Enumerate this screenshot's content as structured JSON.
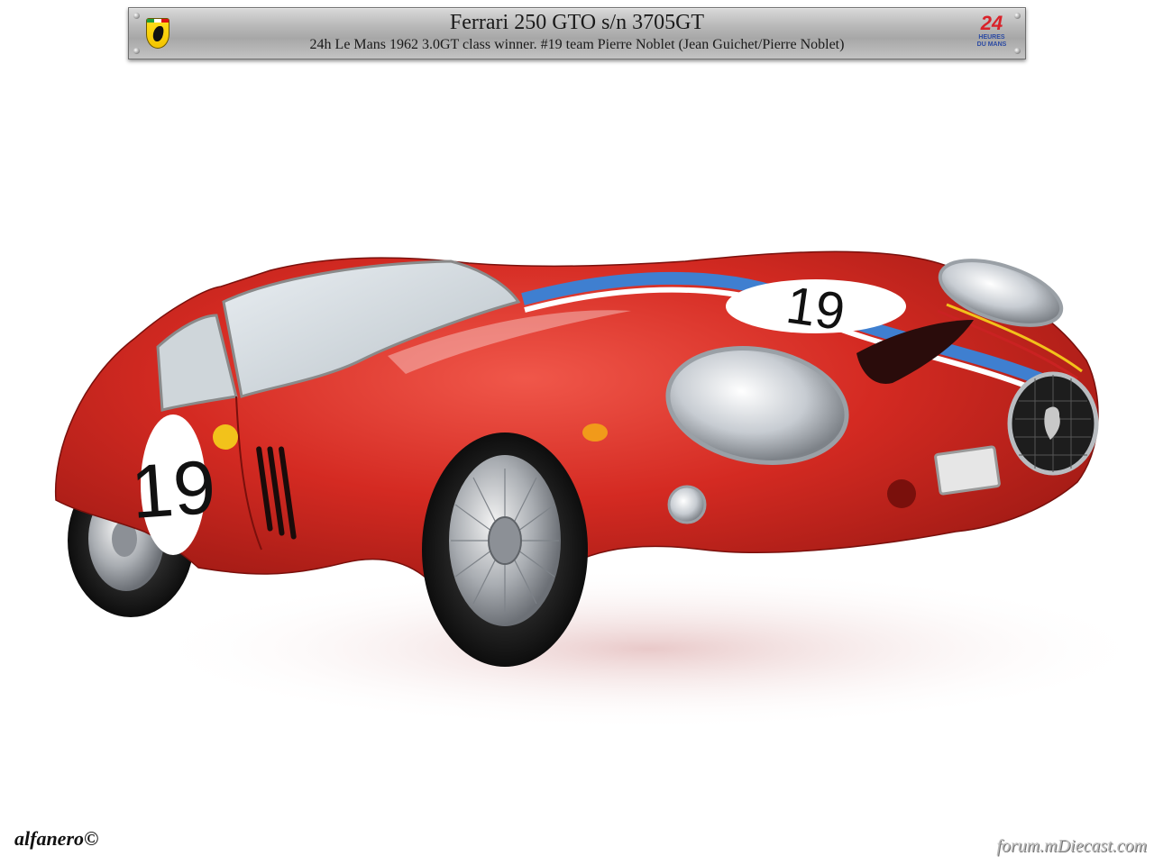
{
  "header": {
    "title": "Ferrari 250 GTO s/n 3705GT",
    "subtitle": "24h Le Mans 1962  3.0GT class winner. #19 team Pierre Noblet (Jean Guichet/Pierre Noblet)",
    "left_logo": "ferrari-shield-icon",
    "right_logo": "le-mans-24-icon",
    "right_logo_text": [
      "24",
      "HEURES",
      "DU MANS"
    ]
  },
  "photo": {
    "subject": "red race car",
    "race_number": "19",
    "colors": {
      "body_red": "#d42a22",
      "stripe_blue": "#3f7fd0",
      "stripe_white": "#ffffff",
      "background": "#ffffff"
    }
  },
  "watermarks": {
    "signature": "alfanero©",
    "forum": "forum.mDiecast.com"
  }
}
